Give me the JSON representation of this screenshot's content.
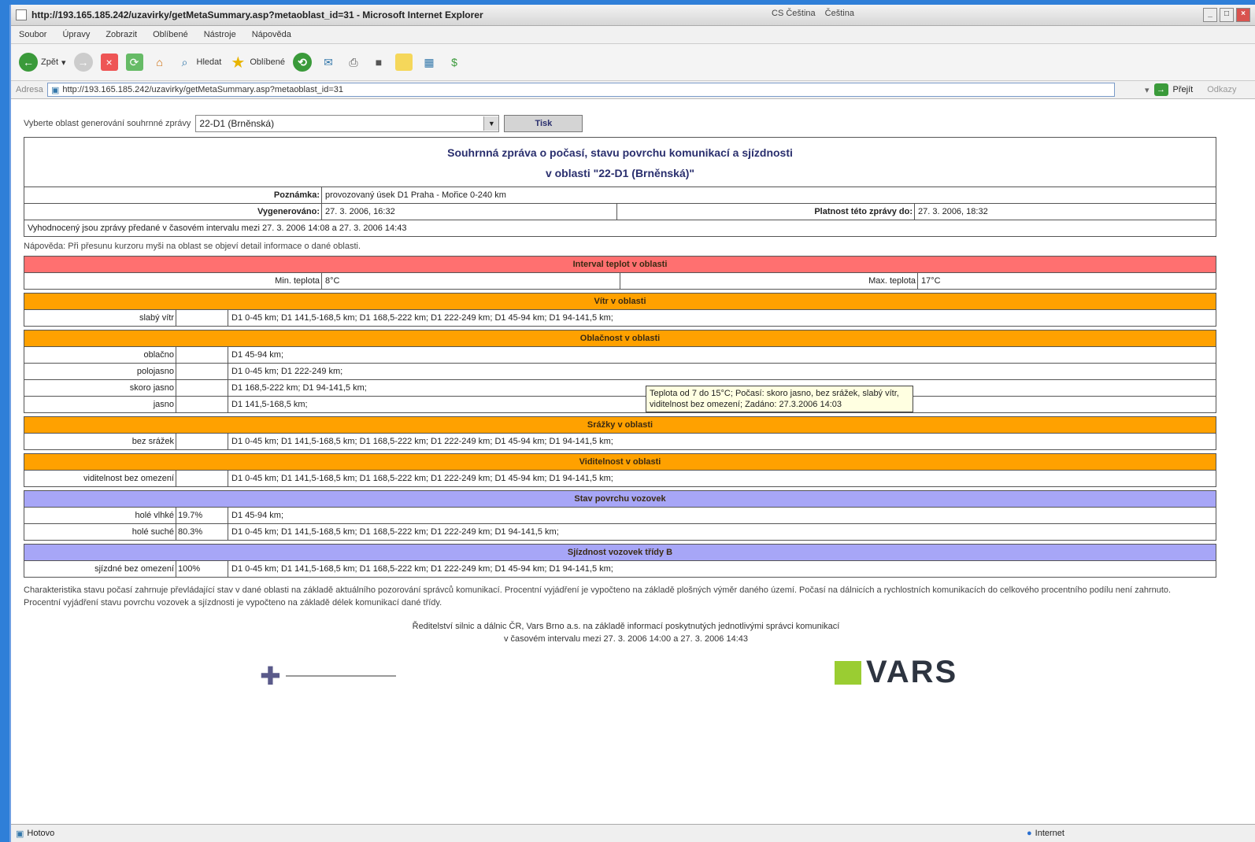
{
  "window": {
    "title": "http://193.165.185.242/uzavirky/getMetaSummary.asp?metaoblast_id=31 - Microsoft Internet Explorer",
    "lang1": "CS Čeština",
    "lang2": "Čeština"
  },
  "menu": [
    "Soubor",
    "Úpravy",
    "Zobrazit",
    "Oblíbené",
    "Nástroje",
    "Nápověda"
  ],
  "toolbar": {
    "back": "Zpět",
    "search": "Hledat",
    "favorites": "Oblíbené"
  },
  "address": {
    "label": "Adresa",
    "url": "http://193.165.185.242/uzavirky/getMetaSummary.asp?metaoblast_id=31",
    "go": "Přejít",
    "links": "Odkazy"
  },
  "form": {
    "label": "Vyberte oblast generování souhrnné zprávy",
    "selected": "22-D1 (Brněnská)",
    "button": "Tisk"
  },
  "report": {
    "title1": "Souhrnná zpráva o počasí, stavu povrchu komunikací a sjízdnosti",
    "title2": "v oblasti \"22-D1 (Brněnská)\"",
    "note_label": "Poznámka:",
    "note_value": "provozovaný úsek D1 Praha - Mořice 0-240 km",
    "generated_label": "Vygenerováno:",
    "generated_value": "27. 3. 2006, 16:32",
    "valid_label": "Platnost této zprávy do:",
    "valid_value": "27. 3. 2006, 18:32",
    "interval_text": "Vyhodnocený jsou zprávy předané v časovém intervalu mezi 27. 3. 2006 14:08 a 27. 3. 2006 14:43"
  },
  "hint": "Nápověda: Při přesunu kurzoru myši na oblast se objeví detail informace o dané oblasti.",
  "temperature": {
    "title": "Interval teplot v oblasti",
    "min_label": "Min. teplota",
    "min_value": "8°C",
    "max_label": "Max. teplota",
    "max_value": "17°C"
  },
  "sections": [
    {
      "title": "Vítr v oblasti",
      "color": "orange",
      "rows": [
        {
          "label": "slabý vítr",
          "pct": "",
          "desc": "D1 0-45 km; D1 141,5-168,5 km; D1 168,5-222 km; D1 222-249 km; D1 45-94 km; D1 94-141,5 km;"
        }
      ]
    },
    {
      "title": "Oblačnost v oblasti",
      "color": "orange",
      "rows": [
        {
          "label": "oblačno",
          "pct": "",
          "desc": "D1 45-94 km;"
        },
        {
          "label": "polojasno",
          "pct": "",
          "desc": "D1 0-45 km; D1 222-249 km;"
        },
        {
          "label": "skoro jasno",
          "pct": "",
          "desc": "D1 168,5-222 km; D1 94-141,5 km;"
        },
        {
          "label": "jasno",
          "pct": "",
          "desc": "D1 141,5-168,5 km;"
        }
      ]
    },
    {
      "title": "Srážky v oblasti",
      "color": "orange",
      "rows": [
        {
          "label": "bez srážek",
          "pct": "",
          "desc": "D1 0-45 km; D1 141,5-168,5 km; D1 168,5-222 km; D1 222-249 km; D1 45-94 km; D1 94-141,5 km;"
        }
      ]
    },
    {
      "title": "Viditelnost v oblasti",
      "color": "orange",
      "rows": [
        {
          "label": "viditelnost bez omezení",
          "pct": "",
          "desc": "D1 0-45 km; D1 141,5-168,5 km; D1 168,5-222 km; D1 222-249 km; D1 45-94 km; D1 94-141,5 km;"
        }
      ]
    },
    {
      "title": "Stav povrchu vozovek",
      "color": "blue",
      "rows": [
        {
          "label": "holé vlhké",
          "pct": "19.7%",
          "desc": "D1 45-94 km;"
        },
        {
          "label": "holé suché",
          "pct": "80.3%",
          "desc": "D1 0-45 km; D1 141,5-168,5 km; D1 168,5-222 km; D1 222-249 km; D1 94-141,5 km;"
        }
      ]
    },
    {
      "title": "Sjízdnost vozovek třídy B",
      "color": "blue",
      "rows": [
        {
          "label": "sjízdné bez omezení",
          "pct": "100%",
          "desc": "D1 0-45 km; D1 141,5-168,5 km; D1 168,5-222 km; D1 222-249 km; D1 45-94 km; D1 94-141,5 km;"
        }
      ]
    }
  ],
  "tooltip": "Teplota od 7 do 15°C; Počasí: skoro jasno, bez srážek, slabý vítr, viditelnost bez omezení; Zadáno: 27.3.2006 14:03",
  "footer": {
    "text": "Charakteristika stavu počasí zahrnuje převládající stav v dané oblasti na základě aktuálního pozorování správců komunikací. Procentní vyjádření je vypočteno na základě plošných výměr daného území. Počasí na dálnicích a rychlostních komunikacích do celkového procentního podílu není zahrnuto. Procentní vyjádření stavu povrchu vozovek a sjízdnosti je vypočteno na základě délek komunikací dané třídy.",
    "center1": "Ředitelství silnic a dálnic ČR, Vars Brno a.s. na základě informací poskytnutých jednotlivými správci komunikací",
    "center2": "v časovém intervalu mezi 27. 3. 2006 14:00 a 27. 3. 2006 14:43",
    "logo_text": "VARS"
  },
  "status": {
    "left": "Hotovo",
    "right": "Internet"
  },
  "colors": {
    "red": "#ff7070",
    "orange": "#ffa100",
    "blue": "#a7a6f7"
  }
}
